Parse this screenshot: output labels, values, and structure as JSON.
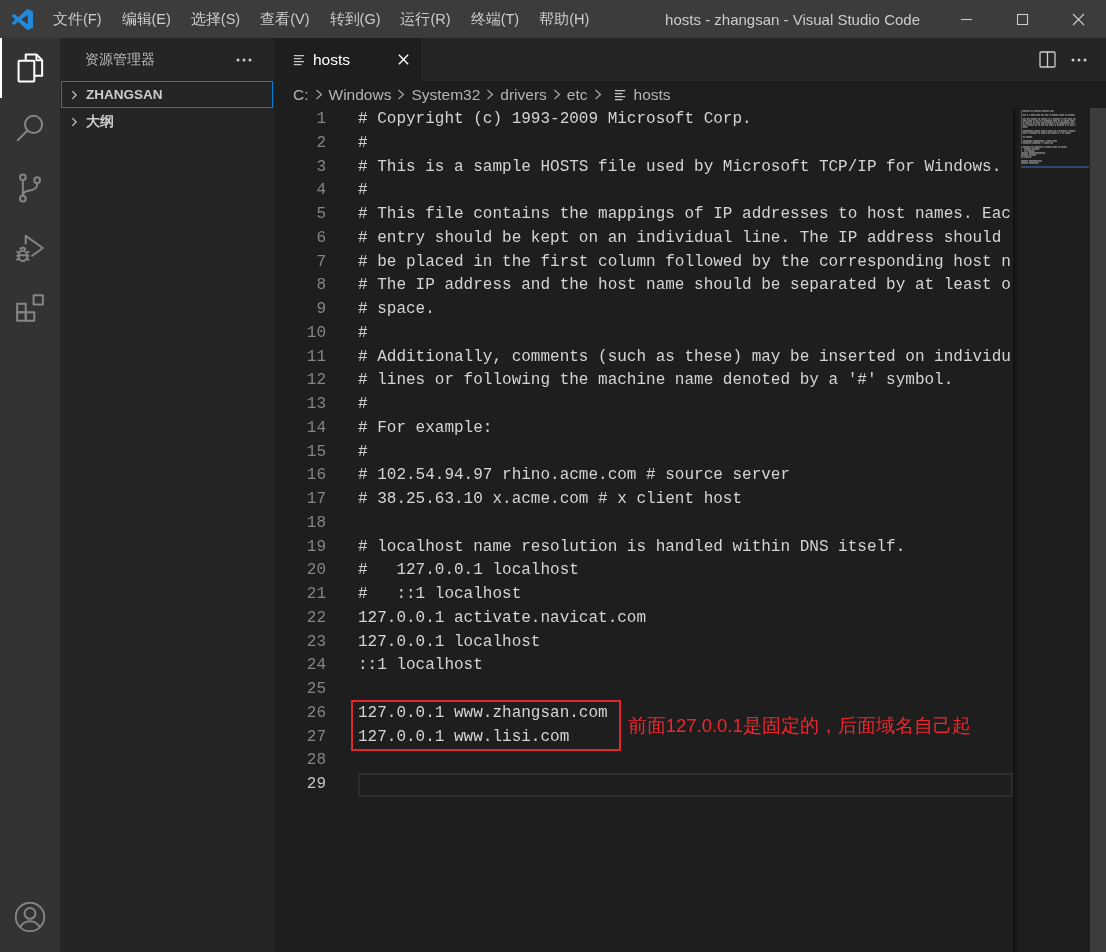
{
  "title_bar": {
    "menu": [
      "文件(F)",
      "编辑(E)",
      "选择(S)",
      "查看(V)",
      "转到(G)",
      "运行(R)",
      "终端(T)",
      "帮助(H)"
    ],
    "title": "hosts - zhangsan - Visual Studio Code"
  },
  "activity_bar": {
    "items": [
      {
        "kind": "explorer",
        "selected": true
      },
      {
        "kind": "search",
        "selected": false
      },
      {
        "kind": "source_control",
        "selected": false
      },
      {
        "kind": "run_debug",
        "selected": false
      },
      {
        "kind": "extensions",
        "selected": false
      }
    ],
    "bottom_items": [
      {
        "kind": "accounts",
        "selected": false
      }
    ]
  },
  "sidebar": {
    "title": "资源管理器",
    "sections": [
      {
        "label": "ZHANGSAN",
        "expanded": false,
        "focused": true
      },
      {
        "label": "大纲",
        "expanded": false,
        "focused": false
      }
    ]
  },
  "tabs": [
    {
      "label": "hosts",
      "selected": true
    }
  ],
  "breadcrumb": [
    {
      "label": "C:",
      "kind": "folder"
    },
    {
      "label": "Windows",
      "kind": "folder"
    },
    {
      "label": "System32",
      "kind": "folder"
    },
    {
      "label": "drivers",
      "kind": "folder"
    },
    {
      "label": "etc",
      "kind": "folder"
    },
    {
      "label": "hosts",
      "kind": "file"
    }
  ],
  "editor": {
    "lines": [
      {
        "kind": "line",
        "number": "1",
        "text": "# Copyright (c) 1993-2009 Microsoft Corp.",
        "current": false
      },
      {
        "kind": "line",
        "number": "2",
        "text": "#",
        "current": false
      },
      {
        "kind": "line",
        "number": "3",
        "text": "# This is a sample HOSTS file used by Microsoft TCP/IP for Windows.",
        "current": false
      },
      {
        "kind": "line",
        "number": "4",
        "text": "#",
        "current": false
      },
      {
        "kind": "line",
        "number": "5",
        "text": "# This file contains the mappings of IP addresses to host names. Eac",
        "current": false
      },
      {
        "kind": "line",
        "number": "6",
        "text": "# entry should be kept on an individual line. The IP address should",
        "current": false
      },
      {
        "kind": "line",
        "number": "7",
        "text": "# be placed in the first column followed by the corresponding host n",
        "current": false
      },
      {
        "kind": "line",
        "number": "8",
        "text": "# The IP address and the host name should be separated by at least o",
        "current": false
      },
      {
        "kind": "line",
        "number": "9",
        "text": "# space.",
        "current": false
      },
      {
        "kind": "line",
        "number": "10",
        "text": "#",
        "current": false
      },
      {
        "kind": "line",
        "number": "11",
        "text": "# Additionally, comments (such as these) may be inserted on individu",
        "current": false
      },
      {
        "kind": "line",
        "number": "12",
        "text": "# lines or following the machine name denoted by a '#' symbol.",
        "current": false
      },
      {
        "kind": "line",
        "number": "13",
        "text": "#",
        "current": false
      },
      {
        "kind": "line",
        "number": "14",
        "text": "# For example:",
        "current": false
      },
      {
        "kind": "line",
        "number": "15",
        "text": "#",
        "current": false
      },
      {
        "kind": "line",
        "number": "16",
        "text": "# 102.54.94.97 rhino.acme.com # source server",
        "current": false
      },
      {
        "kind": "line",
        "number": "17",
        "text": "# 38.25.63.10 x.acme.com # x client host",
        "current": false
      },
      {
        "kind": "line",
        "number": "18",
        "current": false
      },
      {
        "kind": "line",
        "number": "19",
        "text": "# localhost name resolution is handled within DNS itself.",
        "current": false
      },
      {
        "kind": "line",
        "number": "20",
        "text": "#   127.0.0.1 localhost",
        "current": false
      },
      {
        "kind": "line",
        "number": "21",
        "text": "#   ::1 localhost",
        "current": false
      },
      {
        "kind": "line",
        "number": "22",
        "text": "127.0.0.1 activate.navicat.com",
        "current": false
      },
      {
        "kind": "line",
        "number": "23",
        "text": "127.0.0.1 localhost",
        "current": false
      },
      {
        "kind": "line",
        "number": "24",
        "text": "::1 localhost",
        "current": false
      },
      {
        "kind": "line",
        "number": "25",
        "current": false
      },
      {
        "kind": "annotated_block",
        "note": "前面127.0.0.1是固定的，后面域名自己起",
        "lines": [
          {
            "number": "26",
            "text": "127.0.0.1 www.zhangsan.com",
            "current": false
          },
          {
            "number": "27",
            "text": "127.0.0.1 www.lisi.com",
            "current": false
          }
        ]
      },
      {
        "kind": "line",
        "number": "28",
        "current": false
      },
      {
        "kind": "line",
        "number": "29",
        "current": true
      }
    ]
  }
}
